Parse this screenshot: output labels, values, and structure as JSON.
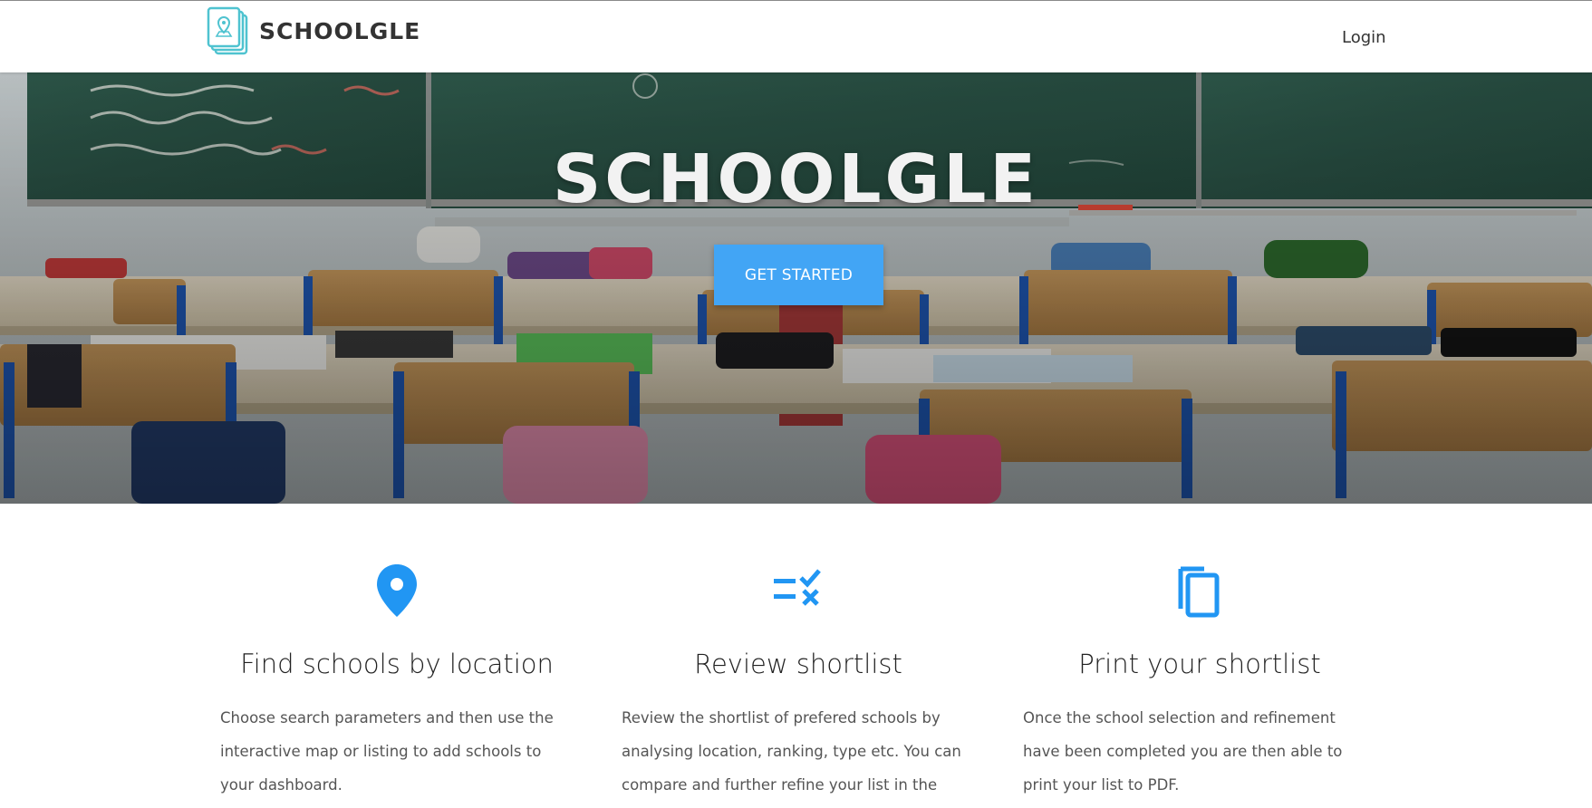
{
  "nav": {
    "brand": "Schoolgle",
    "login": "Login"
  },
  "hero": {
    "title": "Schoolgle",
    "cta": "Get Started"
  },
  "features": [
    {
      "icon": "location-pin-icon",
      "title": "Find schools by location",
      "description": "Choose search parameters and then use the interactive map or listing to add schools to your dashboard."
    },
    {
      "icon": "checklist-icon",
      "title": "Review shortlist",
      "description": "Review the shortlist of prefered schools by analysing location, ranking, type etc. You can compare and further refine your list in the"
    },
    {
      "icon": "copy-pages-icon",
      "title": "Print your shortlist",
      "description": "Once the school selection and refinement have been completed you are then able to print your list to PDF."
    }
  ],
  "colors": {
    "accent": "#42a5f5",
    "icon_blue": "#2196f3",
    "logo_teal": "#4fc3d0",
    "text_dark": "#333333"
  }
}
